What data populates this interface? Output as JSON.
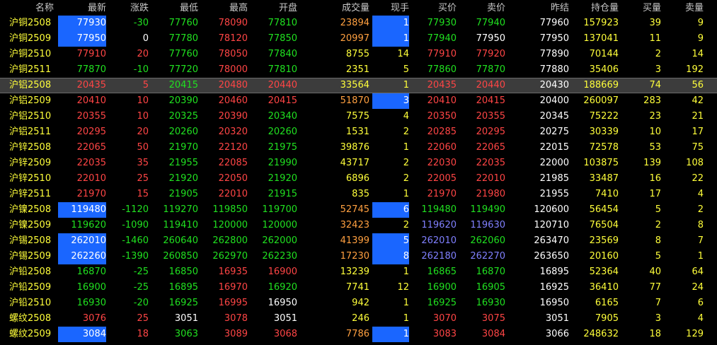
{
  "columns": [
    {
      "key": "name",
      "label": "名称"
    },
    {
      "key": "last",
      "label": "最新"
    },
    {
      "key": "chg",
      "label": "涨跌"
    },
    {
      "key": "low",
      "label": "最低"
    },
    {
      "key": "high",
      "label": "最高"
    },
    {
      "key": "open",
      "label": "开盘"
    },
    {
      "key": "vol",
      "label": "成交量"
    },
    {
      "key": "cur",
      "label": "现手"
    },
    {
      "key": "bid",
      "label": "买价"
    },
    {
      "key": "ask",
      "label": "卖价"
    },
    {
      "key": "prev",
      "label": "昨结"
    },
    {
      "key": "oi",
      "label": "持仓量"
    },
    {
      "key": "bidv",
      "label": "买量"
    },
    {
      "key": "askv",
      "label": "卖量"
    }
  ],
  "colors": {
    "red": "#ff4545",
    "green": "#20e020",
    "white": "#ffffff",
    "yellow": "#ffff3a",
    "orange": "#ffa040",
    "blue": "#8080ff",
    "highlight": "#1a66ff"
  },
  "selected_row": 4,
  "rows": [
    {
      "name": "沪铜2508",
      "last": "77930",
      "chg": "-30",
      "low": "77760",
      "high": "78090",
      "open": "77810",
      "vol": "23894",
      "cur": "1",
      "bid": "77930",
      "ask": "77940",
      "prev": "77960",
      "oi": "157923",
      "bidv": "39",
      "askv": "9",
      "colors": {
        "last": "white",
        "chg": "green",
        "low": "green",
        "high": "red",
        "open": "green",
        "vol": "orange",
        "cur": "white",
        "bid": "green",
        "ask": "green"
      },
      "hl": [
        "last",
        "cur"
      ]
    },
    {
      "name": "沪铜2509",
      "last": "77950",
      "chg": "0",
      "low": "77780",
      "high": "78120",
      "open": "77850",
      "vol": "20997",
      "cur": "1",
      "bid": "77940",
      "ask": "77950",
      "prev": "77950",
      "oi": "137041",
      "bidv": "11",
      "askv": "9",
      "colors": {
        "last": "white",
        "chg": "white",
        "low": "green",
        "high": "red",
        "open": "green",
        "vol": "orange",
        "cur": "white",
        "bid": "green",
        "ask": "white"
      },
      "hl": [
        "last",
        "cur"
      ]
    },
    {
      "name": "沪铜2510",
      "last": "77910",
      "chg": "20",
      "low": "77760",
      "high": "78050",
      "open": "77840",
      "vol": "8755",
      "cur": "14",
      "bid": "77910",
      "ask": "77920",
      "prev": "77890",
      "oi": "70144",
      "bidv": "2",
      "askv": "14",
      "colors": {
        "last": "red",
        "chg": "red",
        "low": "green",
        "high": "red",
        "open": "green",
        "vol": "yellow",
        "cur": "yellow",
        "bid": "red",
        "ask": "red"
      },
      "hl": []
    },
    {
      "name": "沪铜2511",
      "last": "77870",
      "chg": "-10",
      "low": "77720",
      "high": "78000",
      "open": "77810",
      "vol": "2351",
      "cur": "5",
      "bid": "77860",
      "ask": "77870",
      "prev": "77880",
      "oi": "35406",
      "bidv": "3",
      "askv": "192",
      "colors": {
        "last": "green",
        "chg": "green",
        "low": "green",
        "high": "red",
        "open": "green",
        "vol": "yellow",
        "cur": "yellow",
        "bid": "green",
        "ask": "green"
      },
      "hl": []
    },
    {
      "name": "沪铝2508",
      "last": "20435",
      "chg": "5",
      "low": "20415",
      "high": "20480",
      "open": "20440",
      "vol": "33564",
      "cur": "1",
      "bid": "20435",
      "ask": "20440",
      "prev": "20430",
      "oi": "188669",
      "bidv": "74",
      "askv": "56",
      "colors": {
        "last": "red",
        "chg": "red",
        "low": "green",
        "high": "red",
        "open": "red",
        "vol": "yellow",
        "cur": "yellow",
        "bid": "red",
        "ask": "red"
      },
      "hl": []
    },
    {
      "name": "沪铝2509",
      "last": "20410",
      "chg": "10",
      "low": "20390",
      "high": "20460",
      "open": "20415",
      "vol": "51870",
      "cur": "3",
      "bid": "20410",
      "ask": "20415",
      "prev": "20400",
      "oi": "260097",
      "bidv": "283",
      "askv": "42",
      "colors": {
        "last": "red",
        "chg": "red",
        "low": "green",
        "high": "red",
        "open": "red",
        "vol": "orange",
        "cur": "white",
        "bid": "red",
        "ask": "red"
      },
      "hl": [
        "cur"
      ]
    },
    {
      "name": "沪铝2510",
      "last": "20355",
      "chg": "10",
      "low": "20325",
      "high": "20390",
      "open": "20340",
      "vol": "7575",
      "cur": "4",
      "bid": "20350",
      "ask": "20355",
      "prev": "20345",
      "oi": "75222",
      "bidv": "23",
      "askv": "21",
      "colors": {
        "last": "red",
        "chg": "red",
        "low": "green",
        "high": "red",
        "open": "green",
        "vol": "yellow",
        "cur": "yellow",
        "bid": "red",
        "ask": "red"
      },
      "hl": []
    },
    {
      "name": "沪铝2511",
      "last": "20295",
      "chg": "20",
      "low": "20260",
      "high": "20320",
      "open": "20260",
      "vol": "1531",
      "cur": "2",
      "bid": "20285",
      "ask": "20295",
      "prev": "20275",
      "oi": "30339",
      "bidv": "10",
      "askv": "17",
      "colors": {
        "last": "red",
        "chg": "red",
        "low": "green",
        "high": "red",
        "open": "green",
        "vol": "yellow",
        "cur": "yellow",
        "bid": "red",
        "ask": "red"
      },
      "hl": []
    },
    {
      "name": "沪锌2508",
      "last": "22065",
      "chg": "50",
      "low": "21970",
      "high": "22120",
      "open": "21975",
      "vol": "39876",
      "cur": "1",
      "bid": "22060",
      "ask": "22065",
      "prev": "22015",
      "oi": "72578",
      "bidv": "53",
      "askv": "75",
      "colors": {
        "last": "red",
        "chg": "red",
        "low": "green",
        "high": "red",
        "open": "green",
        "vol": "yellow",
        "cur": "yellow",
        "bid": "red",
        "ask": "red"
      },
      "hl": []
    },
    {
      "name": "沪锌2509",
      "last": "22035",
      "chg": "35",
      "low": "21955",
      "high": "22085",
      "open": "21990",
      "vol": "43717",
      "cur": "2",
      "bid": "22030",
      "ask": "22035",
      "prev": "22000",
      "oi": "103875",
      "bidv": "139",
      "askv": "108",
      "colors": {
        "last": "red",
        "chg": "red",
        "low": "green",
        "high": "red",
        "open": "green",
        "vol": "yellow",
        "cur": "yellow",
        "bid": "red",
        "ask": "red"
      },
      "hl": []
    },
    {
      "name": "沪锌2510",
      "last": "22010",
      "chg": "25",
      "low": "21920",
      "high": "22050",
      "open": "21920",
      "vol": "6896",
      "cur": "2",
      "bid": "22005",
      "ask": "22010",
      "prev": "21985",
      "oi": "33487",
      "bidv": "16",
      "askv": "22",
      "colors": {
        "last": "red",
        "chg": "red",
        "low": "green",
        "high": "red",
        "open": "green",
        "vol": "yellow",
        "cur": "yellow",
        "bid": "red",
        "ask": "red"
      },
      "hl": []
    },
    {
      "name": "沪锌2511",
      "last": "21970",
      "chg": "15",
      "low": "21905",
      "high": "22010",
      "open": "21915",
      "vol": "835",
      "cur": "1",
      "bid": "21970",
      "ask": "21980",
      "prev": "21955",
      "oi": "7410",
      "bidv": "17",
      "askv": "4",
      "colors": {
        "last": "red",
        "chg": "red",
        "low": "green",
        "high": "red",
        "open": "green",
        "vol": "yellow",
        "cur": "yellow",
        "bid": "red",
        "ask": "red"
      },
      "hl": []
    },
    {
      "name": "沪镍2508",
      "last": "119480",
      "chg": "-1120",
      "low": "119270",
      "high": "119850",
      "open": "119700",
      "vol": "52745",
      "cur": "6",
      "bid": "119480",
      "ask": "119490",
      "prev": "120600",
      "oi": "56454",
      "bidv": "5",
      "askv": "2",
      "colors": {
        "last": "white",
        "chg": "green",
        "low": "green",
        "high": "green",
        "open": "green",
        "vol": "orange",
        "cur": "white",
        "bid": "green",
        "ask": "green"
      },
      "hl": [
        "last",
        "cur"
      ]
    },
    {
      "name": "沪镍2509",
      "last": "119620",
      "chg": "-1090",
      "low": "119410",
      "high": "120000",
      "open": "120000",
      "vol": "32423",
      "cur": "2",
      "bid": "119620",
      "ask": "119630",
      "prev": "120710",
      "oi": "76504",
      "bidv": "2",
      "askv": "8",
      "colors": {
        "last": "green",
        "chg": "green",
        "low": "green",
        "high": "green",
        "open": "green",
        "vol": "orange",
        "cur": "yellow",
        "bid": "blue",
        "ask": "blue"
      },
      "hl": []
    },
    {
      "name": "沪锡2508",
      "last": "262010",
      "chg": "-1460",
      "low": "260640",
      "high": "262800",
      "open": "262000",
      "vol": "41399",
      "cur": "5",
      "bid": "262010",
      "ask": "262060",
      "prev": "263470",
      "oi": "23569",
      "bidv": "8",
      "askv": "7",
      "colors": {
        "last": "white",
        "chg": "green",
        "low": "green",
        "high": "green",
        "open": "green",
        "vol": "orange",
        "cur": "white",
        "bid": "blue",
        "ask": "green"
      },
      "hl": [
        "last",
        "cur"
      ]
    },
    {
      "name": "沪锡2509",
      "last": "262260",
      "chg": "-1390",
      "low": "260850",
      "high": "262970",
      "open": "262230",
      "vol": "17230",
      "cur": "8",
      "bid": "262180",
      "ask": "262270",
      "prev": "263650",
      "oi": "20160",
      "bidv": "5",
      "askv": "1",
      "colors": {
        "last": "white",
        "chg": "green",
        "low": "green",
        "high": "green",
        "open": "green",
        "vol": "orange",
        "cur": "white",
        "bid": "blue",
        "ask": "blue"
      },
      "hl": [
        "last",
        "cur"
      ]
    },
    {
      "name": "沪铅2508",
      "last": "16870",
      "chg": "-25",
      "low": "16850",
      "high": "16935",
      "open": "16900",
      "vol": "13239",
      "cur": "1",
      "bid": "16865",
      "ask": "16870",
      "prev": "16895",
      "oi": "52364",
      "bidv": "40",
      "askv": "64",
      "colors": {
        "last": "green",
        "chg": "green",
        "low": "green",
        "high": "red",
        "open": "red",
        "vol": "yellow",
        "cur": "yellow",
        "bid": "green",
        "ask": "green"
      },
      "hl": []
    },
    {
      "name": "沪铅2509",
      "last": "16900",
      "chg": "-25",
      "low": "16895",
      "high": "16970",
      "open": "16920",
      "vol": "7741",
      "cur": "12",
      "bid": "16900",
      "ask": "16905",
      "prev": "16925",
      "oi": "36410",
      "bidv": "77",
      "askv": "24",
      "colors": {
        "last": "green",
        "chg": "green",
        "low": "green",
        "high": "red",
        "open": "green",
        "vol": "yellow",
        "cur": "yellow",
        "bid": "green",
        "ask": "green"
      },
      "hl": []
    },
    {
      "name": "沪铅2510",
      "last": "16930",
      "chg": "-20",
      "low": "16925",
      "high": "16995",
      "open": "16950",
      "vol": "942",
      "cur": "1",
      "bid": "16925",
      "ask": "16930",
      "prev": "16950",
      "oi": "6165",
      "bidv": "7",
      "askv": "6",
      "colors": {
        "last": "green",
        "chg": "green",
        "low": "green",
        "high": "red",
        "open": "white",
        "vol": "yellow",
        "cur": "yellow",
        "bid": "green",
        "ask": "green"
      },
      "hl": []
    },
    {
      "name": "螺纹2508",
      "last": "3076",
      "chg": "25",
      "low": "3051",
      "high": "3078",
      "open": "3051",
      "vol": "246",
      "cur": "1",
      "bid": "3070",
      "ask": "3075",
      "prev": "3051",
      "oi": "7905",
      "bidv": "3",
      "askv": "4",
      "colors": {
        "last": "red",
        "chg": "red",
        "low": "white",
        "high": "red",
        "open": "white",
        "vol": "yellow",
        "cur": "yellow",
        "bid": "red",
        "ask": "red"
      },
      "hl": []
    },
    {
      "name": "螺纹2509",
      "last": "3084",
      "chg": "18",
      "low": "3063",
      "high": "3089",
      "open": "3068",
      "vol": "7786",
      "cur": "1",
      "bid": "3083",
      "ask": "3084",
      "prev": "3066",
      "oi": "248632",
      "bidv": "18",
      "askv": "129",
      "colors": {
        "last": "white",
        "chg": "red",
        "low": "green",
        "high": "red",
        "open": "red",
        "vol": "orange",
        "cur": "white",
        "bid": "red",
        "ask": "red"
      },
      "hl": [
        "last",
        "cur"
      ]
    }
  ]
}
